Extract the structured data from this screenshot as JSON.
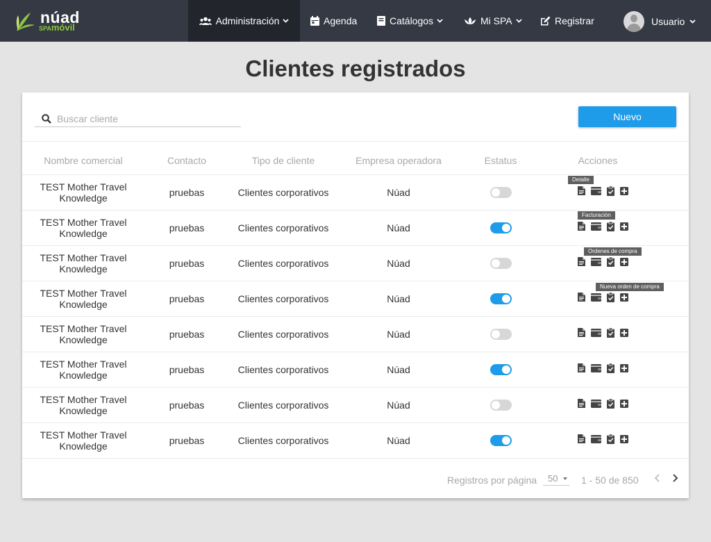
{
  "brand": {
    "name": "núad",
    "sub_prefix": "SPA",
    "sub_main": "móvil"
  },
  "nav": {
    "items": [
      {
        "label": "Administración",
        "icon": "users-icon",
        "dropdown": true,
        "active": true
      },
      {
        "label": "Agenda",
        "icon": "calendar-icon",
        "dropdown": false,
        "active": false
      },
      {
        "label": "Catálogos",
        "icon": "book-icon",
        "dropdown": true,
        "active": false
      },
      {
        "label": "Mi SPA",
        "icon": "lotus-icon",
        "dropdown": true,
        "active": false
      },
      {
        "label": "Registrar",
        "icon": "edit-icon",
        "dropdown": false,
        "active": false
      }
    ],
    "user_label": "Usuario"
  },
  "page": {
    "title": "Clientes registrados"
  },
  "search": {
    "placeholder": "Buscar cliente"
  },
  "new_button": "Nuevo",
  "table": {
    "headers": [
      "Nombre  comercial",
      "Contacto",
      "Tipo de cliente",
      "Empresa operadora",
      "Estatus",
      "Acciones"
    ],
    "rows": [
      {
        "name": "TEST Mother Travel Knowledge",
        "contact": "pruebas",
        "type": "Clientes corporativos",
        "company": "Núad",
        "status": false
      },
      {
        "name": "TEST Mother Travel Knowledge",
        "contact": "pruebas",
        "type": "Clientes corporativos",
        "company": "Núad",
        "status": true
      },
      {
        "name": "TEST Mother Travel Knowledge",
        "contact": "pruebas",
        "type": "Clientes corporativos",
        "company": "Núad",
        "status": false
      },
      {
        "name": "TEST Mother Travel Knowledge",
        "contact": "pruebas",
        "type": "Clientes corporativos",
        "company": "Núad",
        "status": true
      },
      {
        "name": "TEST Mother Travel Knowledge",
        "contact": "pruebas",
        "type": "Clientes corporativos",
        "company": "Núad",
        "status": false
      },
      {
        "name": "TEST Mother Travel Knowledge",
        "contact": "pruebas",
        "type": "Clientes corporativos",
        "company": "Núad",
        "status": true
      },
      {
        "name": "TEST Mother Travel Knowledge",
        "contact": "pruebas",
        "type": "Clientes corporativos",
        "company": "Núad",
        "status": false
      },
      {
        "name": "TEST Mother Travel Knowledge",
        "contact": "pruebas",
        "type": "Clientes corporativos",
        "company": "Núad",
        "status": true
      }
    ],
    "action_icons": [
      "document-icon",
      "wallet-icon",
      "clipboard-check-icon",
      "plus-square-icon"
    ],
    "tooltips": [
      "Detalle",
      "Facturación",
      "Ordenes de compra",
      "Nueva orden de compra"
    ]
  },
  "pagination": {
    "label": "Registros por página",
    "per_page": "50",
    "range": "1 - 50 de 850"
  },
  "colors": {
    "navbar": "#343944",
    "nav_active": "#22252b",
    "accent": "#1e9be9",
    "brand_green": "#8dc63f"
  }
}
